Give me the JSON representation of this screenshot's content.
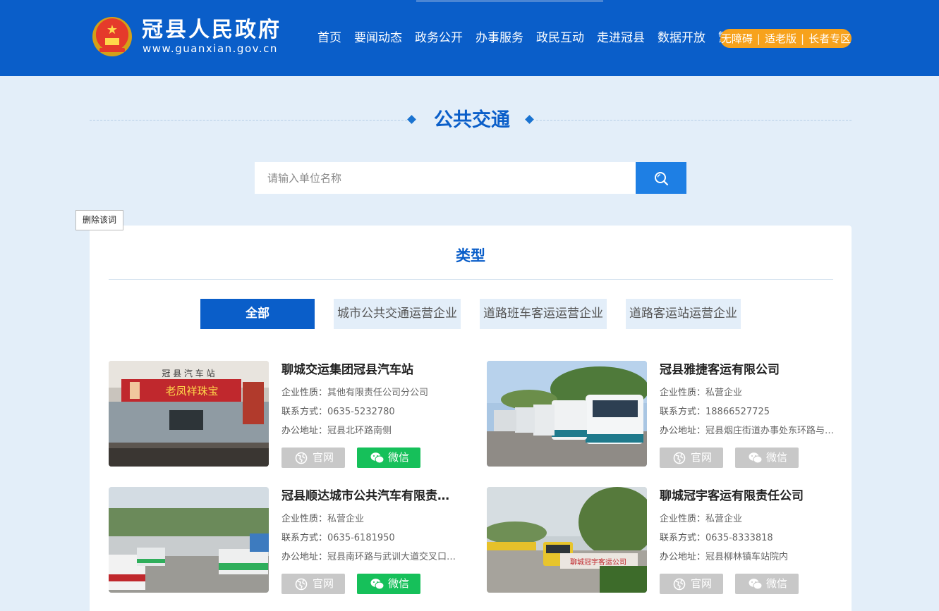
{
  "header": {
    "site_name": "冠县人民政府",
    "site_url": "www.guanxian.gov.cn",
    "nav": [
      "首页",
      "要闻动态",
      "政务公开",
      "办事服务",
      "政民互动",
      "走进冠县",
      "数据开放",
      "繁"
    ],
    "accessibility": [
      "无障碍",
      "适老版",
      "长者专区"
    ],
    "colors": {
      "header_bg": "#0a5ec9",
      "pill": "#f7a21c"
    }
  },
  "page_title": "公共交通",
  "search": {
    "placeholder": "请输入单位名称"
  },
  "tooltip": "删除该词",
  "panel": {
    "title": "类型",
    "filters": [
      "全部",
      "城市公共交通运营企业",
      "道路班车客运运营企业",
      "道路客运站运营企业"
    ],
    "active_filter": "全部"
  },
  "labels": {
    "type": "企业性质：",
    "phone": "联系方式：",
    "address": "办公地址：",
    "web_btn": "官网",
    "wechat_btn": "微信"
  },
  "companies": [
    {
      "name": "聊城交运集团冠县汽车站",
      "type": "其他有限责任公司分公司",
      "phone": "0635-5232780",
      "address": "冠县北环路南侧",
      "wechat_active": true,
      "photo_sign": "冠 县 汽 车 站",
      "photo_banner": "老凤祥珠宝"
    },
    {
      "name": "冠县雅捷客运有限公司",
      "type": "私营企业",
      "phone": "18866527725",
      "address": "冠县烟庄街道办事处东环路与…",
      "wechat_active": false
    },
    {
      "name": "冠县顺达城市公共汽车有限责任…",
      "type": "私营企业",
      "phone": "0635-6181950",
      "address": "冠县南环路与武训大道交叉口…",
      "wechat_active": true
    },
    {
      "name": "聊城冠宇客运有限责任公司",
      "type": "私营企业",
      "phone": "0635-8333818",
      "address": "冠县柳林镇车站院内",
      "wechat_active": false,
      "photo_wall_text": "聊城冠宇客运公司"
    }
  ],
  "accent_colors": {
    "wechat_active": "#16c05a",
    "button_disabled": "#c8c8c8",
    "title_blue": "#0a5ec9"
  }
}
